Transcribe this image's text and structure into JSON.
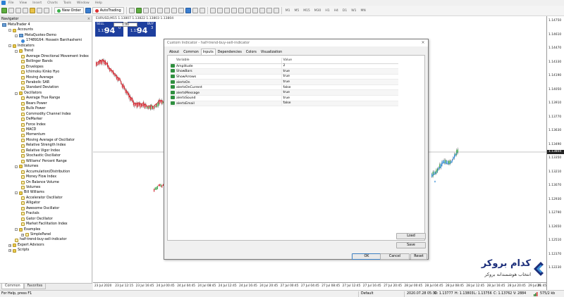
{
  "menu": [
    "File",
    "View",
    "Insert",
    "Charts",
    "Tools",
    "Window",
    "Help"
  ],
  "toolbar": {
    "new_order": "New Order",
    "autotrading": "AutoTrading",
    "timeframes": [
      "M1",
      "M5",
      "M15",
      "M30",
      "H1",
      "H4",
      "D1",
      "W1",
      "MN"
    ]
  },
  "navigator": {
    "title": "Navigator",
    "tree": [
      {
        "label": "MetaTrader 4",
        "level": 0,
        "icon": "platform-icon",
        "ex": ""
      },
      {
        "label": "Accounts",
        "level": 1,
        "icon": "folder-icon",
        "ex": "-"
      },
      {
        "label": "MetaQuotes-Demo",
        "level": 2,
        "icon": "server-icon",
        "ex": "-"
      },
      {
        "label": "17489164: Hossein Banihashemi",
        "level": 3,
        "icon": "account-icon",
        "ex": ""
      },
      {
        "label": "Indicators",
        "level": 1,
        "icon": "folder-icon",
        "ex": "-"
      },
      {
        "label": "Trend",
        "level": 2,
        "icon": "folder-icon",
        "ex": "-"
      },
      {
        "label": "Average Directional Movement Index",
        "level": 3,
        "icon": "indicator-icon",
        "ex": ""
      },
      {
        "label": "Bollinger Bands",
        "level": 3,
        "icon": "indicator-icon",
        "ex": ""
      },
      {
        "label": "Envelopes",
        "level": 3,
        "icon": "indicator-icon",
        "ex": ""
      },
      {
        "label": "Ichimoku Kinko Hyo",
        "level": 3,
        "icon": "indicator-icon",
        "ex": ""
      },
      {
        "label": "Moving Average",
        "level": 3,
        "icon": "indicator-icon",
        "ex": ""
      },
      {
        "label": "Parabolic SAR",
        "level": 3,
        "icon": "indicator-icon",
        "ex": ""
      },
      {
        "label": "Standard Deviation",
        "level": 3,
        "icon": "indicator-icon",
        "ex": ""
      },
      {
        "label": "Oscillators",
        "level": 2,
        "icon": "folder-icon",
        "ex": "-"
      },
      {
        "label": "Average True Range",
        "level": 3,
        "icon": "indicator-icon",
        "ex": ""
      },
      {
        "label": "Bears Power",
        "level": 3,
        "icon": "indicator-icon",
        "ex": ""
      },
      {
        "label": "Bulls Power",
        "level": 3,
        "icon": "indicator-icon",
        "ex": ""
      },
      {
        "label": "Commodity Channel Index",
        "level": 3,
        "icon": "indicator-icon",
        "ex": ""
      },
      {
        "label": "DeMarker",
        "level": 3,
        "icon": "indicator-icon",
        "ex": ""
      },
      {
        "label": "Force Index",
        "level": 3,
        "icon": "indicator-icon",
        "ex": ""
      },
      {
        "label": "MACD",
        "level": 3,
        "icon": "indicator-icon",
        "ex": ""
      },
      {
        "label": "Momentum",
        "level": 3,
        "icon": "indicator-icon",
        "ex": ""
      },
      {
        "label": "Moving Average of Oscillator",
        "level": 3,
        "icon": "indicator-icon",
        "ex": ""
      },
      {
        "label": "Relative Strength Index",
        "level": 3,
        "icon": "indicator-icon",
        "ex": ""
      },
      {
        "label": "Relative Vigor Index",
        "level": 3,
        "icon": "indicator-icon",
        "ex": ""
      },
      {
        "label": "Stochastic Oscillator",
        "level": 3,
        "icon": "indicator-icon",
        "ex": ""
      },
      {
        "label": "Williams' Percent Range",
        "level": 3,
        "icon": "indicator-icon",
        "ex": ""
      },
      {
        "label": "Volumes",
        "level": 2,
        "icon": "folder-icon",
        "ex": "-"
      },
      {
        "label": "Accumulation/Distribution",
        "level": 3,
        "icon": "indicator-icon",
        "ex": ""
      },
      {
        "label": "Money Flow Index",
        "level": 3,
        "icon": "indicator-icon",
        "ex": ""
      },
      {
        "label": "On Balance Volume",
        "level": 3,
        "icon": "indicator-icon",
        "ex": ""
      },
      {
        "label": "Volumes",
        "level": 3,
        "icon": "indicator-icon",
        "ex": ""
      },
      {
        "label": "Bill Williams",
        "level": 2,
        "icon": "folder-icon",
        "ex": "-"
      },
      {
        "label": "Accelerator Oscillator",
        "level": 3,
        "icon": "indicator-icon",
        "ex": ""
      },
      {
        "label": "Alligator",
        "level": 3,
        "icon": "indicator-icon",
        "ex": ""
      },
      {
        "label": "Awesome Oscillator",
        "level": 3,
        "icon": "indicator-icon",
        "ex": ""
      },
      {
        "label": "Fractals",
        "level": 3,
        "icon": "indicator-icon",
        "ex": ""
      },
      {
        "label": "Gator Oscillator",
        "level": 3,
        "icon": "indicator-icon",
        "ex": ""
      },
      {
        "label": "Market Facilitation Index",
        "level": 3,
        "icon": "indicator-icon",
        "ex": ""
      },
      {
        "label": "Examples",
        "level": 2,
        "icon": "folder-icon",
        "ex": "-"
      },
      {
        "label": "SimplePanel",
        "level": 3,
        "icon": "indicator-icon",
        "ex": "+"
      },
      {
        "label": "half-trend-buy-sell-indicator",
        "level": 2,
        "icon": "indicator-icon",
        "ex": ""
      },
      {
        "label": "Expert Advisors",
        "level": 1,
        "icon": "folder-icon",
        "ex": "+"
      },
      {
        "label": "Scripts",
        "level": 1,
        "icon": "folder-icon",
        "ex": "+"
      }
    ],
    "tabs": [
      "Common",
      "Favorites"
    ]
  },
  "chart": {
    "symbol_label": "EURUSD,M15  1.13807 1.13822 1.13803 1.13804",
    "one_click": {
      "sell_label": "SELL",
      "buy_label": "BUY",
      "lot": "1.00",
      "sell_prefix": "1.13",
      "sell_big": "94",
      "sell_sup": "0",
      "buy_prefix": "1.13",
      "buy_big": "94",
      "buy_sup": "3"
    },
    "price_ticks": [
      "1.14750",
      "1.14610",
      "1.14470",
      "1.14330",
      "1.14190",
      "1.14050",
      "1.13910",
      "1.13770",
      "1.13630",
      "1.13490",
      "1.13350",
      "1.13210",
      "1.13070",
      "1.12930",
      "1.12790",
      "1.12650",
      "1.12510",
      "1.12370",
      "1.12230"
    ],
    "current_price": "1.13804",
    "time_ticks": [
      "23 Jul 2020",
      "23 Jul 12:15",
      "23 Jul 16:45",
      "24 Jul 00:45",
      "24 Jul 04:45",
      "24 Jul 08:45",
      "24 Jul 12:45",
      "24 Jul 16:45",
      "24 Jul 20:45",
      "27 Jul 00:45",
      "27 Jul 04:45",
      "27 Jul 08:45",
      "27 Jul 12:45",
      "27 Jul 16:45",
      "27 Jul 20:45",
      "28 Jul 00:45",
      "28 Jul 04:45",
      "28 Jul 08:45",
      "28 Jul 12:45",
      "28 Jul 16:45",
      "28 Jul 20:45",
      "29 Jul 01:45",
      "29"
    ]
  },
  "dialog": {
    "title": "Custom Indicator - half-trend-buy-sell-indicator",
    "tabs": [
      "About",
      "Common",
      "Inputs",
      "Dependencies",
      "Colors",
      "Visualization"
    ],
    "active_tab": "Inputs",
    "col_variable": "Variable",
    "col_value": "Value",
    "params": [
      {
        "name": "Amplitude",
        "value": "2"
      },
      {
        "name": "ShowBars",
        "value": "true"
      },
      {
        "name": "ShowArrows",
        "value": "true"
      },
      {
        "name": "alertsOn",
        "value": "true"
      },
      {
        "name": "alertsOnCurrent",
        "value": "false"
      },
      {
        "name": "alertsMessage",
        "value": "true"
      },
      {
        "name": "alertsSound",
        "value": "true"
      },
      {
        "name": "alertsEmail",
        "value": "false"
      }
    ],
    "load_label": "Load",
    "save_label": "Save",
    "ok_label": "OK",
    "cancel_label": "Cancel",
    "reset_label": "Reset"
  },
  "status": {
    "help": "For Help, press F1",
    "profile": "Default",
    "datetime": "2020.07.28 05:30",
    "open": "O: 1.13777",
    "high": "H: 1.13803",
    "low": "L: 1.13756",
    "close": "C: 1.13762",
    "volume": "V: 2884",
    "traffic": "575/2 kb"
  },
  "watermark": {
    "title": "کدام بروکر",
    "subtitle": "انتخاب هوشمندانه بروکر"
  },
  "colors": {
    "bull": "#2e9e3e",
    "bear": "#d1202a",
    "trend_blue": "#3a8fd8",
    "oct_blue": "#1e3f9e"
  }
}
